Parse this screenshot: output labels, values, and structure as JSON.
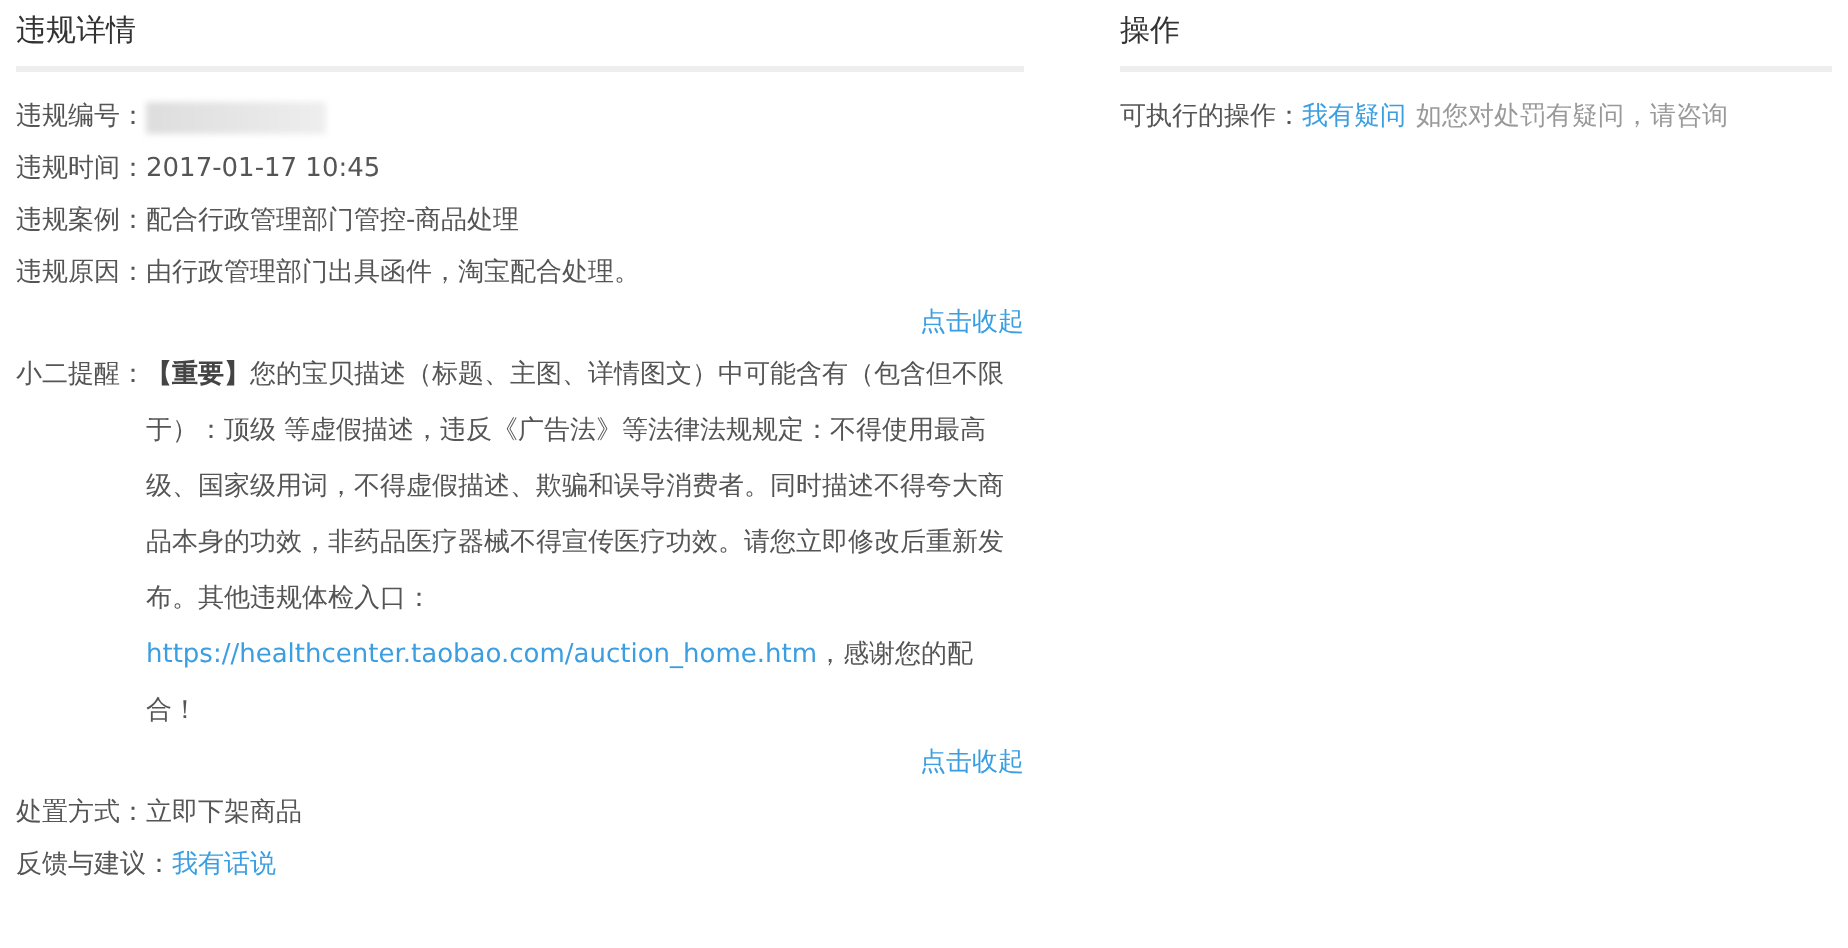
{
  "details": {
    "title": "违规详情",
    "rows": [
      {
        "kind": "redacted",
        "label": "违规编号："
      },
      {
        "kind": "text",
        "label": "违规时间：",
        "value": "2017-01-17 10:45"
      },
      {
        "kind": "text",
        "label": "违规案例：",
        "value": "配合行政管理部门管控-商品处理"
      },
      {
        "kind": "text",
        "label": "违规原因：",
        "value": "由行政管理部门出具函件，淘宝配合处理。"
      }
    ],
    "collapse_top": "点击收起",
    "reminder": {
      "label": "小二提醒：",
      "text_before": "**【重要】**您的宝贝描述（标题、主图、详情图文）中可能含有（包含但不限于）：顶级 等虚假描述，违反《广告法》等法律法规规定：不得使用最高级、国家级用词，不得虚假描述、欺骗和误导消费者。同时描述不得夸大商品本身的功效，非药品医疗器械不得宣传医疗功效。请您立即修改后重新发布。其他违规体检入口：",
      "link": "https://healthcenter.taobao.com/auction_home.htm",
      "text_after": "，感谢您的配合！"
    },
    "collapse_bottom": "点击收起",
    "handling": {
      "label": "处置方式：",
      "value": "立即下架商品"
    },
    "feedback": {
      "label": "反馈与建议：",
      "link": "我有话说"
    }
  },
  "actions": {
    "title": "操作",
    "label": "可执行的操作：",
    "link": "我有疑问",
    "hint": "如您对处罚有疑问，请咨询"
  }
}
